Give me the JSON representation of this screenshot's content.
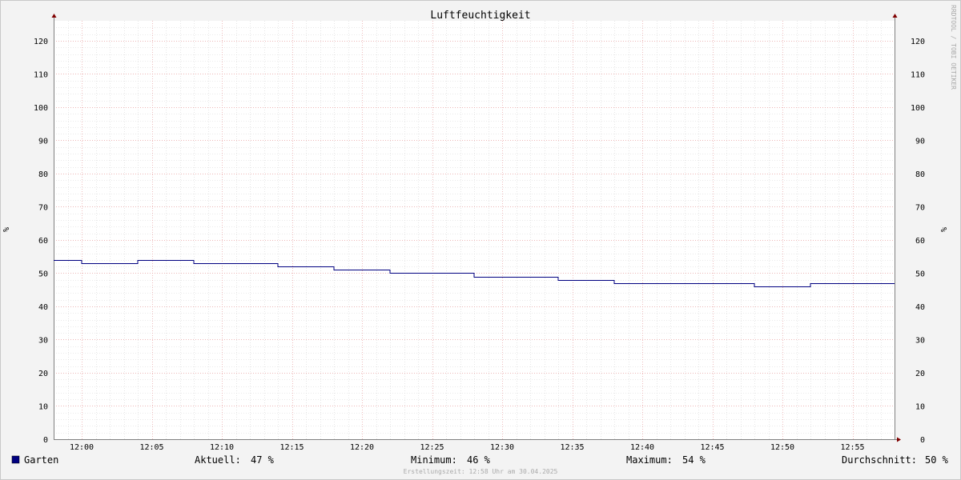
{
  "chart_data": {
    "type": "line",
    "title": "Luftfeuchtigkeit",
    "ylabel": "%",
    "ylim": [
      0,
      126
    ],
    "yticks": [
      0,
      10,
      20,
      30,
      40,
      50,
      60,
      70,
      80,
      90,
      100,
      110,
      120
    ],
    "xlim": [
      "11:58",
      "12:58"
    ],
    "xticks": [
      "12:00",
      "12:05",
      "12:10",
      "12:15",
      "12:20",
      "12:25",
      "12:30",
      "12:35",
      "12:40",
      "12:45",
      "12:50",
      "12:55"
    ],
    "grid": true,
    "legend": "bottom",
    "series": [
      {
        "name": "Garten",
        "color": "#000080",
        "step": true,
        "x": [
          "11:58",
          "12:00",
          "12:04",
          "12:08",
          "12:14",
          "12:18",
          "12:22",
          "12:28",
          "12:34",
          "12:38",
          "12:48",
          "12:52"
        ],
        "values": [
          54,
          53,
          54,
          53,
          52,
          51,
          50,
          49,
          48,
          47,
          46,
          47
        ]
      }
    ],
    "stats": {
      "current_label": "Aktuell:",
      "current_value": "47 %",
      "min_label": "Minimum:",
      "min_value": "46 %",
      "max_label": "Maximum:",
      "max_value": "54 %",
      "avg_label": "Durchschnitt:",
      "avg_value": "50 %"
    },
    "footer": "Erstellungszeit: 12:58 Uhr am 30.04.2025",
    "watermark": "RRDTOOL / TOBI OETIKER"
  },
  "colors": {
    "plot_background": "#ffffff",
    "frame_background": "#f3f3f3",
    "minor_grid": "#d6d6d6",
    "major_grid": "#e8a0a0",
    "axis": "#808080",
    "arrow": "#800000",
    "series": "#000080"
  }
}
